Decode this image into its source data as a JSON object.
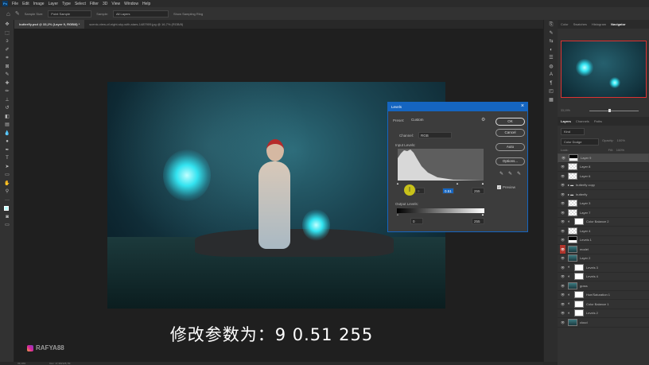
{
  "menu": {
    "logo": "Ps",
    "items": [
      "File",
      "Edit",
      "Image",
      "Layer",
      "Type",
      "Select",
      "Filter",
      "3D",
      "View",
      "Window",
      "Help"
    ]
  },
  "options": {
    "sample_size_label": "Sample Size:",
    "sample_size_value": "Point Sample",
    "sample_label": "Sample:",
    "sample_value": "All Layers",
    "sampling_ring": "Show Sampling Ring"
  },
  "tabs": [
    {
      "label": "butterfly.psd @ 33,2% (Layer 9, RGB/8) *"
    },
    {
      "label": "scenic-view-of-night-sky-with-stars-1487909.jpg @ 16,7% (RGB/8)"
    }
  ],
  "subtitle": "修改参数为：9 0.51 255",
  "watermark": "RAFYA88",
  "status": {
    "zoom": "33,19%",
    "doc": "Doc: 17,3M/125,7M"
  },
  "levels": {
    "title": "Levels",
    "preset_label": "Preset:",
    "preset_value": "Custom",
    "channel_label": "Channel:",
    "channel_value": "RGB",
    "input_label": "Input Levels:",
    "input_black": "9",
    "input_gamma": "0.51",
    "input_white": "255",
    "output_label": "Output Levels:",
    "output_black": "0",
    "output_white": "255",
    "ok": "OK",
    "cancel": "Cancel",
    "auto": "Auto",
    "options": "Options...",
    "preview_label": "Preview",
    "preview_checked": true,
    "accent": "#1565c0"
  },
  "panels": {
    "top_tabs": [
      "Color",
      "Swatches",
      "Histogram",
      "Navigator"
    ],
    "active_top": "Navigator",
    "nav_zoom": "33,19%",
    "layer_tabs": [
      "Layers",
      "Channels",
      "Paths"
    ],
    "kind": "Kind",
    "blend_mode": "Color Dodge",
    "opacity_label": "Opacity:",
    "opacity": "100%",
    "lock_label": "Lock:",
    "fill_label": "Fill:",
    "fill": "100%"
  },
  "layers": [
    {
      "name": "Layer 9",
      "thumb": "mask",
      "selected": true
    },
    {
      "name": "Layer 8",
      "thumb": "trans"
    },
    {
      "name": "Layer 6",
      "thumb": "trans"
    },
    {
      "name": "butterfly copy",
      "thumb": "folder"
    },
    {
      "name": "butterfly",
      "thumb": "folder"
    },
    {
      "name": "Layer 3",
      "thumb": "trans"
    },
    {
      "name": "Layer 7",
      "thumb": "trans"
    },
    {
      "name": "Color Balance 2",
      "thumb": "white"
    },
    {
      "name": "Layer 4",
      "thumb": "trans"
    },
    {
      "name": "Levels 1",
      "thumb": "mask"
    },
    {
      "name": "model",
      "thumb": "photo",
      "red": true
    },
    {
      "name": "Layer 2",
      "thumb": "photo"
    },
    {
      "name": "Levels 3",
      "thumb": "white"
    },
    {
      "name": "Levels 4",
      "thumb": "white"
    },
    {
      "name": "grass",
      "thumb": "photo"
    },
    {
      "name": "Hue/Saturation 1",
      "thumb": "white"
    },
    {
      "name": "Color Balance 1",
      "thumb": "white"
    },
    {
      "name": "Levels 2",
      "thumb": "white"
    },
    {
      "name": "cloud",
      "thumb": "photo"
    }
  ]
}
